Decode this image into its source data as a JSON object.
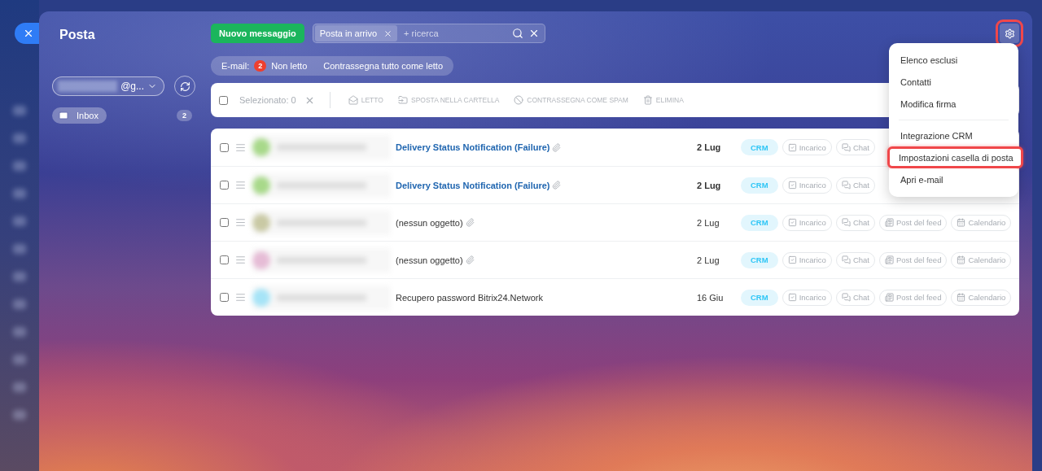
{
  "sidebar": {
    "title": "Posta",
    "account": {
      "label": "@g..."
    },
    "folders": [
      {
        "label": "Inbox",
        "count": "2",
        "selected": true
      }
    ]
  },
  "toolbar": {
    "new_button": "Nuovo messaggio",
    "search": {
      "chip": "Posta in arrivo",
      "placeholder": "+ ricerca"
    },
    "settings": {
      "highlighted": true
    }
  },
  "filter_bar": {
    "label": "E-mail:",
    "badge": "2",
    "filter": "Non letto",
    "mark_all": "Contrassegna tutto come letto"
  },
  "selection_bar": {
    "checked": false,
    "label": "Selezionato: 0",
    "actions": [
      {
        "label": "LETTO",
        "disabled": true
      },
      {
        "label": "SPOSTA NELLA CARTELLA",
        "disabled": true
      },
      {
        "label": "CONTRASSEGNA COME SPAM",
        "disabled": true
      },
      {
        "label": "ELIMINA",
        "disabled": true
      }
    ]
  },
  "messages": [
    {
      "color": "#a8d98a",
      "subject": "Delivery Status Notification (Failure)",
      "unread": true,
      "attachment": true,
      "date": "2 Lug",
      "checked": false,
      "tags": [
        {
          "label": "CRM",
          "kind": "crm"
        },
        {
          "label": "Incarico",
          "kind": "action"
        },
        {
          "label": "Chat",
          "kind": "action"
        }
      ]
    },
    {
      "color": "#a8d98a",
      "subject": "Delivery Status Notification (Failure)",
      "unread": true,
      "attachment": true,
      "date": "2 Lug",
      "checked": false,
      "tags": [
        {
          "label": "CRM",
          "kind": "crm"
        },
        {
          "label": "Incarico",
          "kind": "action"
        },
        {
          "label": "Chat",
          "kind": "action"
        }
      ]
    },
    {
      "color": "#c9c9a4",
      "subject": "(nessun oggetto)",
      "unread": false,
      "attachment": true,
      "date": "2 Lug",
      "checked": false,
      "tags": [
        {
          "label": "CRM",
          "kind": "crm"
        },
        {
          "label": "Incarico",
          "kind": "action"
        },
        {
          "label": "Chat",
          "kind": "action"
        },
        {
          "label": "Post del feed",
          "kind": "action"
        },
        {
          "label": "Calendario",
          "kind": "action"
        }
      ]
    },
    {
      "color": "#e6bcd6",
      "subject": "(nessun oggetto)",
      "unread": false,
      "attachment": true,
      "date": "2 Lug",
      "checked": false,
      "tags": [
        {
          "label": "CRM",
          "kind": "crm"
        },
        {
          "label": "Incarico",
          "kind": "action"
        },
        {
          "label": "Chat",
          "kind": "action"
        },
        {
          "label": "Post del feed",
          "kind": "action"
        },
        {
          "label": "Calendario",
          "kind": "action"
        }
      ]
    },
    {
      "color": "#a6e4f7",
      "subject": "Recupero password Bitrix24.Network",
      "unread": false,
      "attachment": false,
      "date": "16 Giu",
      "checked": false,
      "tags": [
        {
          "label": "CRM",
          "kind": "crm"
        },
        {
          "label": "Incarico",
          "kind": "action"
        },
        {
          "label": "Chat",
          "kind": "action"
        },
        {
          "label": "Post del feed",
          "kind": "action"
        },
        {
          "label": "Calendario",
          "kind": "action"
        }
      ]
    }
  ],
  "settings_menu": [
    {
      "label": "Elenco esclusi",
      "highlighted": false,
      "separator_before": false
    },
    {
      "label": "Contatti",
      "highlighted": false,
      "separator_before": false
    },
    {
      "label": "Modifica firma",
      "highlighted": false,
      "separator_before": false
    },
    {
      "label": "Integrazione CRM",
      "highlighted": false,
      "separator_before": true
    },
    {
      "label": "Impostazioni casella di posta",
      "highlighted": true,
      "separator_before": false
    },
    {
      "label": "Apri e-mail",
      "highlighted": false,
      "separator_before": false
    }
  ]
}
